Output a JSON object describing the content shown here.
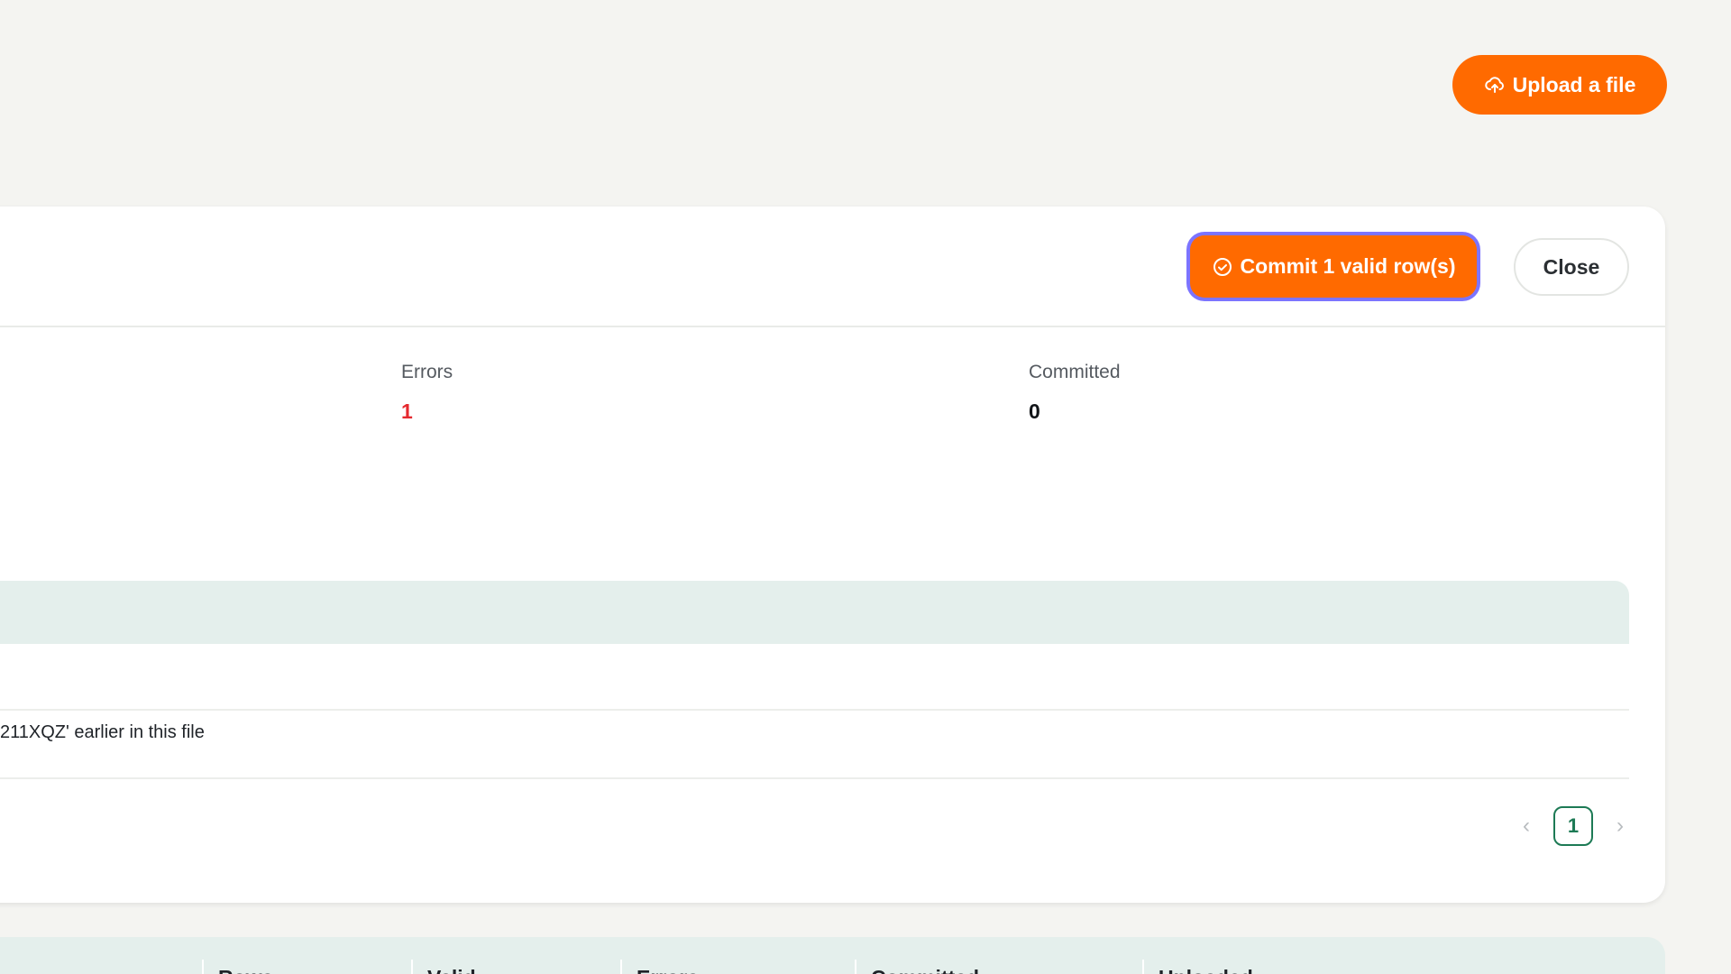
{
  "toolbar": {
    "upload_label": "Upload a file"
  },
  "card": {
    "commit_label": "Commit 1 valid row(s)",
    "close_label": "Close",
    "stats": {
      "errors_label": "Errors",
      "errors_value": "1",
      "committed_label": "Committed",
      "committed_value": "0"
    },
    "error_message": "211XQZ' earlier in this file",
    "pagination": {
      "current_page": "1"
    }
  },
  "history": {
    "columns": [
      "Rows",
      "Valid",
      "Errors",
      "Committed",
      "Uploaded"
    ]
  },
  "colors": {
    "accent": "#ff6a00",
    "error": "#e5292f",
    "pagination": "#1d7a55",
    "table_header": "#e4efec"
  }
}
